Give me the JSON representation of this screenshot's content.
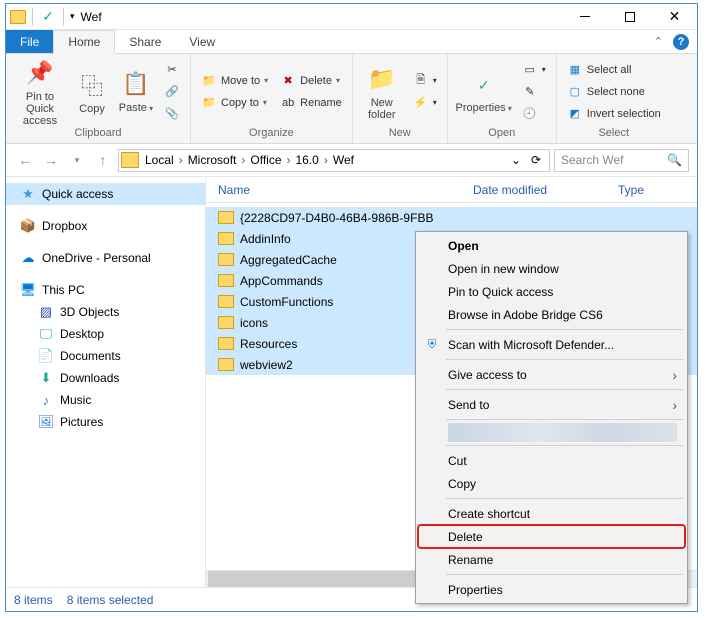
{
  "title": "Wef",
  "tabs": {
    "file": "File",
    "home": "Home",
    "share": "Share",
    "view": "View"
  },
  "ribbon": {
    "clipboard": {
      "label": "Clipboard",
      "pin": "Pin to Quick\naccess",
      "copy": "Copy",
      "paste": "Paste"
    },
    "organize": {
      "label": "Organize",
      "moveto": "Move to",
      "copyto": "Copy to",
      "delete": "Delete",
      "rename": "Rename"
    },
    "new": {
      "label": "New",
      "newfolder": "New\nfolder"
    },
    "open": {
      "label": "Open",
      "properties": "Properties"
    },
    "select": {
      "label": "Select",
      "all": "Select all",
      "none": "Select none",
      "invert": "Invert selection"
    }
  },
  "breadcrumb": {
    "items": [
      "Local",
      "Microsoft",
      "Office",
      "16.0",
      "Wef"
    ]
  },
  "search_placeholder": "Search Wef",
  "nav": {
    "quickaccess": "Quick access",
    "dropbox": "Dropbox",
    "onedrive": "OneDrive - Personal",
    "thispc": "This PC",
    "child": {
      "objects": "3D Objects",
      "desktop": "Desktop",
      "documents": "Documents",
      "downloads": "Downloads",
      "music": "Music",
      "pictures": "Pictures"
    }
  },
  "columns": {
    "name": "Name",
    "date": "Date modified",
    "type": "Type"
  },
  "files": [
    "{2228CD97-D4B0-46B4-986B-9FBB",
    "AddinInfo",
    "AggregatedCache",
    "AppCommands",
    "CustomFunctions",
    "icons",
    "Resources",
    "webview2"
  ],
  "status": {
    "count": "8 items",
    "selected": "8 items selected"
  },
  "ctx": {
    "open": "Open",
    "opennew": "Open in new window",
    "pinquick": "Pin to Quick access",
    "bridge": "Browse in Adobe Bridge CS6",
    "defender": "Scan with Microsoft Defender...",
    "giveaccess": "Give access to",
    "sendto": "Send to",
    "cut": "Cut",
    "copy": "Copy",
    "shortcut": "Create shortcut",
    "delete": "Delete",
    "rename": "Rename",
    "properties": "Properties"
  }
}
